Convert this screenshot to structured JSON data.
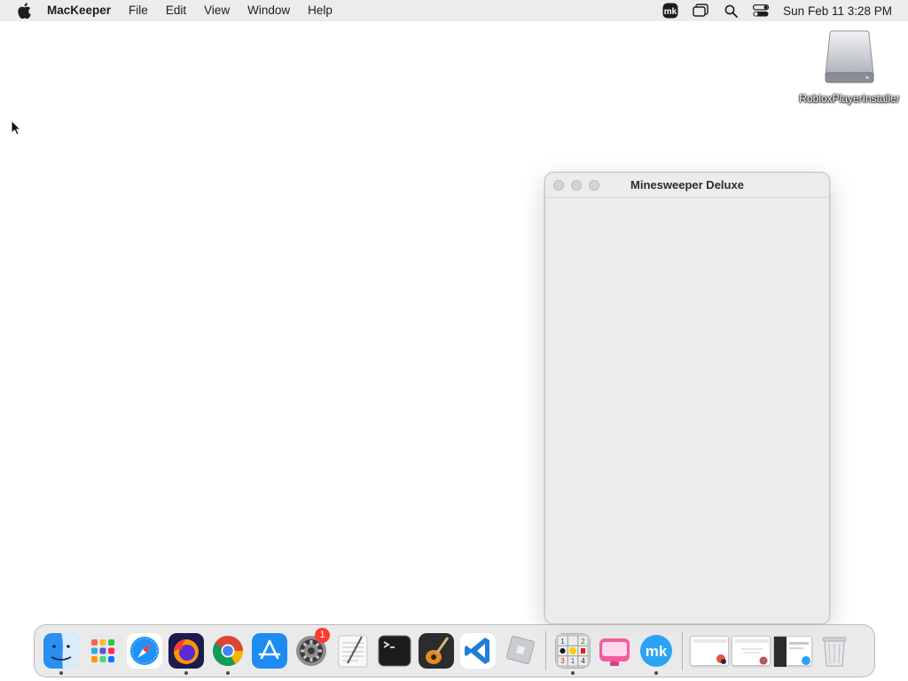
{
  "menubar": {
    "apple_icon": "apple-logo-icon",
    "app_name": "MacKeeper",
    "items": [
      "File",
      "Edit",
      "View",
      "Window",
      "Help"
    ],
    "status_icons": [
      "mackeeper-status-icon",
      "screen-mirroring-icon",
      "spotlight-search-icon",
      "control-center-icon"
    ],
    "clock": "Sun Feb 11  3:28 PM"
  },
  "desktop": {
    "icons": [
      {
        "label": "RobloxPlayerInstaller",
        "icon": "external-disk-icon"
      }
    ]
  },
  "window": {
    "title": "Minesweeper Deluxe"
  },
  "dock": {
    "apps": [
      {
        "name": "Finder",
        "icon": "finder-icon",
        "running": true
      },
      {
        "name": "Launchpad",
        "icon": "launchpad-icon",
        "running": false
      },
      {
        "name": "Safari",
        "icon": "safari-icon",
        "running": false
      },
      {
        "name": "Firefox",
        "icon": "firefox-icon",
        "running": true
      },
      {
        "name": "Google Chrome",
        "icon": "chrome-icon",
        "running": true
      },
      {
        "name": "App Store",
        "icon": "app-store-icon",
        "running": false
      },
      {
        "name": "System Settings",
        "icon": "system-settings-icon",
        "running": false,
        "badge": "1"
      },
      {
        "name": "TextEdit",
        "icon": "textedit-icon",
        "running": false
      },
      {
        "name": "Terminal",
        "icon": "terminal-icon",
        "running": false
      },
      {
        "name": "GarageBand",
        "icon": "garageband-icon",
        "running": false
      },
      {
        "name": "Visual Studio Code",
        "icon": "vscode-icon",
        "running": false
      },
      {
        "name": "Roblox",
        "icon": "roblox-icon",
        "running": false
      },
      {
        "name": "Minesweeper Deluxe",
        "icon": "minesweeper-icon",
        "running": true
      },
      {
        "name": "CleanMyMac",
        "icon": "cleanmymac-icon",
        "running": false
      },
      {
        "name": "MacKeeper",
        "icon": "mackeeper-icon",
        "running": true
      }
    ],
    "minimized": [
      "minimized-window-1",
      "minimized-window-2",
      "minimized-window-3"
    ],
    "trash_icon": "trash-icon"
  },
  "colors": {
    "menubar_bg": "#ececec",
    "window_bg": "#ececec",
    "badge": "#ff3b30"
  }
}
